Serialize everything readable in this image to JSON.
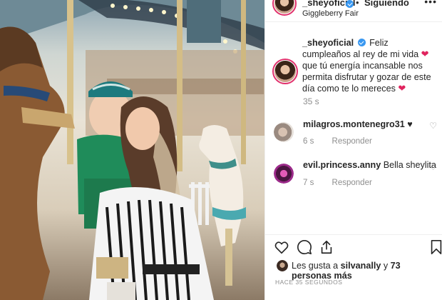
{
  "post": {
    "header": {
      "username": "_sheyoficial",
      "separator": "•",
      "follow_status": "Siguiendo",
      "location": "Giggleberry Fair",
      "more_icon": "more-icon"
    },
    "caption": {
      "username": "_sheyoficial",
      "text_part1": "Feliz cumpleaños al rey de mi vida",
      "text_part2": "que tú energía incansable nos permita disfrutar y gozar de este día como te lo mereces",
      "emoji": "❤"
    },
    "caption_time": "35 s",
    "comments": [
      {
        "username": "milagros.montenegro31",
        "text": "♥",
        "time": "6 s",
        "reply": "Responder"
      },
      {
        "username": "evil.princess.anny",
        "text": "Bella sheylita",
        "time": "7 s",
        "reply": "Responder"
      }
    ],
    "likes": {
      "prefix": "Les gusta a",
      "first_user": "silvanally",
      "conjunction": "y",
      "others": "73 personas más"
    },
    "timestamp": "HACE 35 SEGUNDOS"
  },
  "colors": {
    "verified": "#3897f0",
    "heart": "#e0245e",
    "muted": "#8e8e8e",
    "text": "#262626",
    "story_ring": "#e1306c"
  },
  "icons": [
    "heart-outline-icon",
    "comment-icon",
    "share-icon",
    "bookmark-icon",
    "verified-badge-icon",
    "small-heart-icon",
    "more-icon"
  ]
}
